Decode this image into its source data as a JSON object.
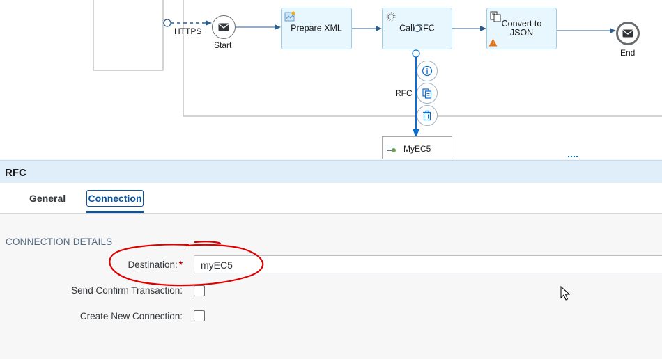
{
  "diagram": {
    "sender_adapter_label": "HTTPS",
    "start_label": "Start",
    "end_label": "End",
    "steps": [
      {
        "label": "Prepare XML",
        "icon": "script-icon"
      },
      {
        "label": "Call RFC",
        "icon": "gear-icon"
      },
      {
        "label": "Convert to JSON",
        "icon": "converter-icon",
        "warning": true
      }
    ],
    "receiver_adapter_label": "RFC",
    "receiver_label": "MyEC5",
    "actions": [
      "info-icon",
      "copy-icon",
      "delete-icon"
    ]
  },
  "panel": {
    "title": "RFC",
    "tabs": [
      {
        "label": "General",
        "active": false
      },
      {
        "label": "Connection",
        "active": true
      }
    ],
    "section_title": "CONNECTION DETAILS",
    "fields": {
      "destination": {
        "label": "Destination:",
        "required": true,
        "value": "myEC5"
      },
      "send_confirm": {
        "label": "Send Confirm Transaction:",
        "checked": false
      },
      "create_new": {
        "label": "Create New Connection:",
        "checked": false
      }
    }
  },
  "colors": {
    "accent": "#0854a0",
    "step_fill": "#e8f6fd",
    "annotation": "#e00000",
    "warning": "#e9730c"
  }
}
